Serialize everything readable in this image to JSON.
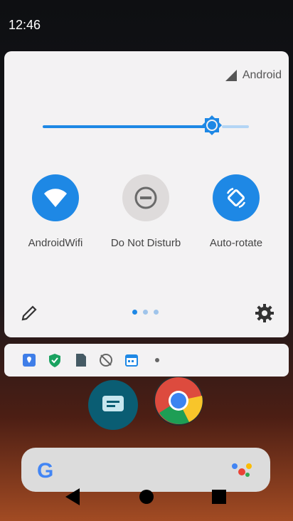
{
  "status": {
    "time": "12:46"
  },
  "panel": {
    "network_name": "Android",
    "brightness": 0.82,
    "tiles": [
      {
        "label": "AndroidWifi",
        "state": "on",
        "icon": "wifi-icon"
      },
      {
        "label": "Do Not Disturb",
        "state": "off",
        "icon": "do-not-disturb-icon"
      },
      {
        "label": "Auto-rotate",
        "state": "on",
        "icon": "auto-rotate-icon"
      }
    ],
    "page_indicator": {
      "pages": 3,
      "current": 1
    }
  },
  "notification_icons": [
    "maps-icon",
    "shield-icon",
    "sd-card-icon",
    "no-location-icon",
    "calendar-icon",
    "dot-icon"
  ],
  "home": {
    "apps": [
      "messages-icon",
      "chrome-icon"
    ],
    "search": "google-search-bar"
  },
  "colors": {
    "accent": "#1e88e5",
    "panel": "#f3f2f3"
  }
}
